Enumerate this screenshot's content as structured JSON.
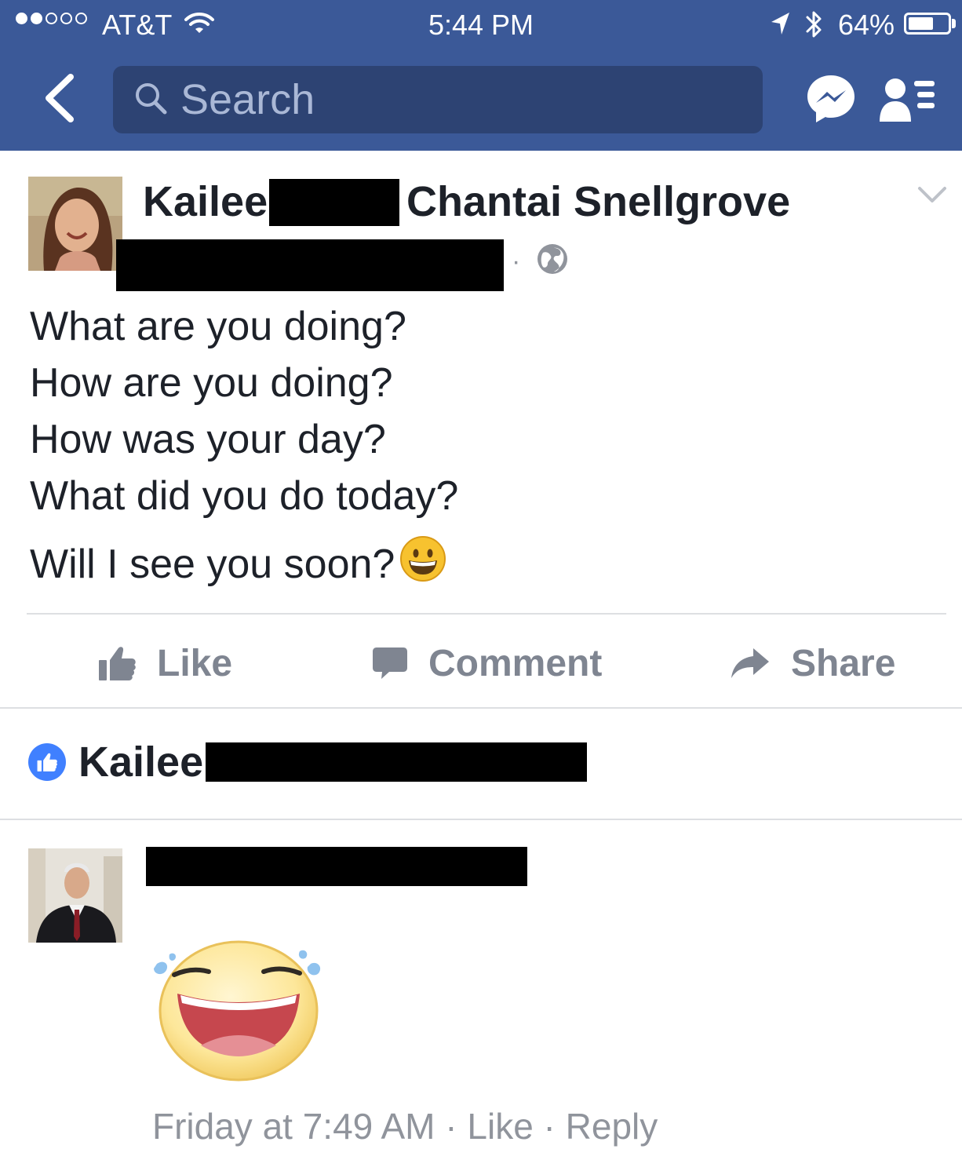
{
  "status_bar": {
    "carrier": "AT&T",
    "time": "5:44 PM",
    "battery_percent": "64%",
    "battery_level": 0.64,
    "signal_bars": 2,
    "signal_total": 5
  },
  "nav": {
    "search_placeholder": "Search",
    "color": "#3b5998",
    "search_bg": "#2d4373"
  },
  "post": {
    "author_first": "Kailee",
    "author_rest": "Chantai Snellgrove",
    "meta_separator": "·",
    "lines": [
      "What are you doing?",
      "How are you doing?",
      "How was your day?",
      "What did you do today?",
      "Will I see you soon?"
    ]
  },
  "actions": {
    "like": "Like",
    "comment": "Comment",
    "share": "Share"
  },
  "reactions": {
    "liker_name": "Kailee"
  },
  "comment": {
    "meta": {
      "time": "Friday at 7:49 AM",
      "sep1": " · ",
      "like": "Like",
      "sep2": " · ",
      "reply": "Reply"
    }
  },
  "icons": {
    "back": "chevron-left-icon",
    "search": "search-icon",
    "messenger": "messenger-icon",
    "friends": "friend-requests-icon",
    "globe": "globe-icon",
    "options": "chevron-down-icon",
    "like": "thumbs-up-icon",
    "comment": "speech-bubble-icon",
    "share": "share-arrow-icon"
  }
}
